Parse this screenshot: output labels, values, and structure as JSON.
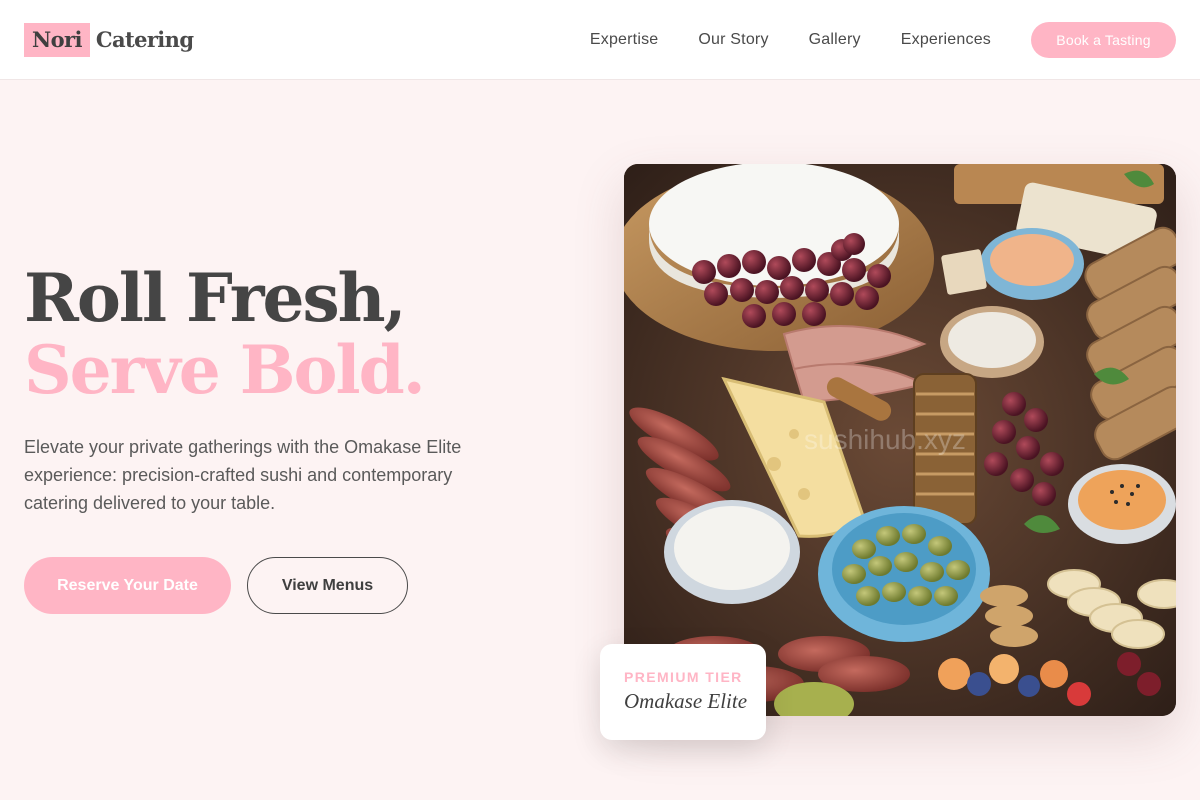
{
  "brand": {
    "logo_box": "Nori",
    "logo_word": "Catering"
  },
  "nav": {
    "links": [
      "Expertise",
      "Our Story",
      "Gallery",
      "Experiences"
    ],
    "cta": "Book a Tasting"
  },
  "hero": {
    "title_line1": "Roll Fresh,",
    "title_line2": "Serve Bold.",
    "subtitle": "Elevate your private gatherings with the Omakase Elite experience: precision-crafted sushi and contemporary catering delivered to your table.",
    "primary_button": "Reserve Your Date",
    "secondary_button": "View Menus"
  },
  "feature_card": {
    "label": "PREMIUM TIER",
    "name": "Omakase Elite"
  },
  "image": {
    "watermark": "sushihub.xyz"
  },
  "colors": {
    "accent": "#ffb5c5",
    "background": "#fdf3f3",
    "text": "#4a4a4a"
  }
}
